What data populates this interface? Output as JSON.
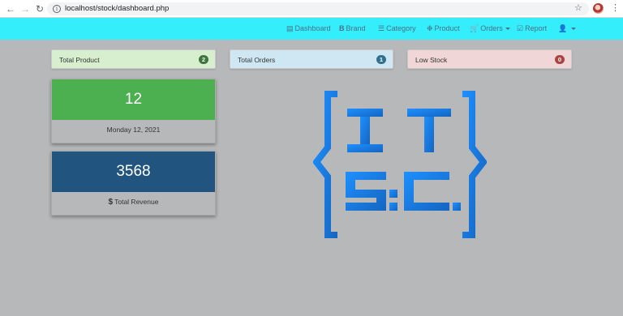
{
  "browser": {
    "url": "localhost/stock/dashboard.php"
  },
  "navbar": {
    "items": [
      {
        "label": "Dashboard",
        "icon": "dashboard-icon"
      },
      {
        "label": "Brand",
        "icon": "brand-icon"
      },
      {
        "label": "Category",
        "icon": "list-icon"
      },
      {
        "label": "Product",
        "icon": "product-icon"
      },
      {
        "label": "Orders",
        "icon": "cart-icon"
      },
      {
        "label": "Report",
        "icon": "check-square-icon"
      }
    ],
    "user_icon": "user-icon",
    "color": "#34eefc"
  },
  "stats": {
    "total_product": {
      "label": "Total Product",
      "count": "2",
      "color": "#3c763d"
    },
    "total_orders": {
      "label": "Total Orders",
      "count": "1",
      "color": "#31708f"
    },
    "low_stock": {
      "label": "Low Stock",
      "count": "0",
      "color": "#a94442"
    }
  },
  "cards": {
    "date_card": {
      "value": "12",
      "caption": "Monday 12, 2021",
      "color": "#4caf50"
    },
    "revenue_card": {
      "value": "3568",
      "caption": "Total Revenue",
      "currency_symbol": "$",
      "color": "#215580"
    }
  },
  "logo": {
    "icon": "itsc-logo",
    "letters_top": [
      "I",
      "T"
    ],
    "letters_bottom": [
      "S",
      "C"
    ],
    "color": "#1a73d6"
  }
}
